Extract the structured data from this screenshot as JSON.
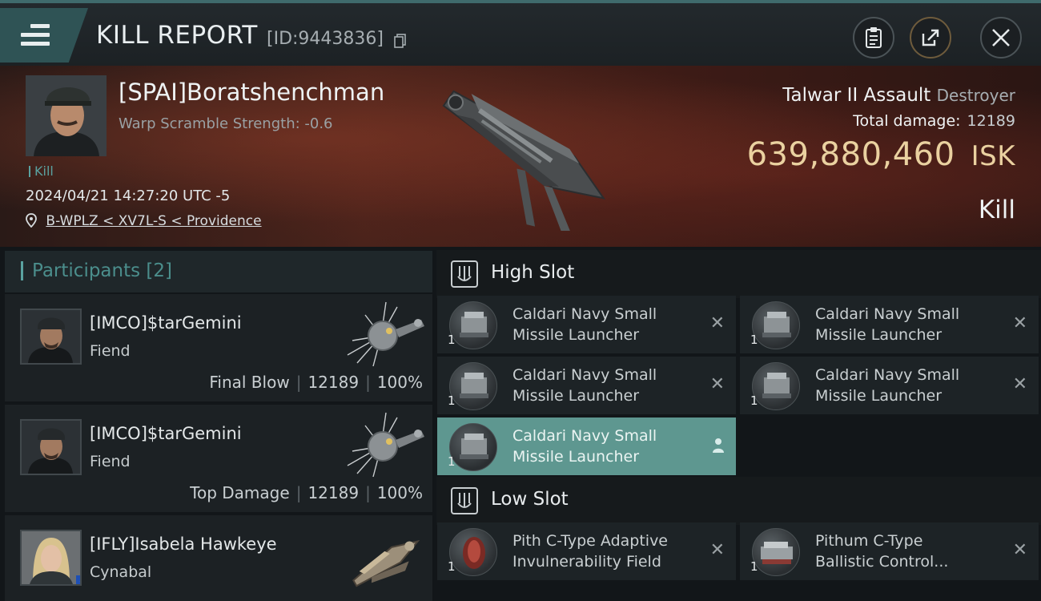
{
  "header": {
    "title": "KILL REPORT",
    "report_id": "[ID:9443836]",
    "icons": [
      "menu-icon",
      "copy-icon",
      "clipboard-icon",
      "share-icon",
      "close-icon"
    ]
  },
  "victim": {
    "name": "[SPAI]Boratshenchman",
    "scramble": "Warp Scramble Strength: -0.6",
    "kill_tag": "Kill",
    "datetime": "2024/04/21 14:27:20 UTC -5",
    "location": "B-WPLZ < XV7L-S < Providence",
    "ship_name": "Talwar II Assault",
    "ship_class": "Destroyer",
    "total_damage_label": "Total damage:",
    "total_damage": "12189",
    "isk_value": "639,880,460",
    "isk_unit": "ISK",
    "result": "Kill"
  },
  "participants": {
    "header": "Participants",
    "count": "[2]",
    "items": [
      {
        "name": "[IMCO]$tarGemini",
        "ship": "Fiend",
        "role": "Final Blow",
        "damage": "12189",
        "percent": "100%"
      },
      {
        "name": "[IMCO]$tarGemini",
        "ship": "Fiend",
        "role": "Top Damage",
        "damage": "12189",
        "percent": "100%"
      },
      {
        "name": "[IFLY]Isabela Hawkeye",
        "ship": "Cynabal",
        "role": "",
        "damage": "",
        "percent": ""
      }
    ]
  },
  "slots": {
    "high": {
      "title": "High Slot",
      "modules": [
        {
          "line1": "Caldari Navy Small",
          "line2": "Missile Launcher",
          "qty": "1",
          "state": "destroyed"
        },
        {
          "line1": "Caldari Navy Small",
          "line2": "Missile Launcher",
          "qty": "1",
          "state": "destroyed"
        },
        {
          "line1": "Caldari Navy Small",
          "line2": "Missile Launcher",
          "qty": "1",
          "state": "destroyed"
        },
        {
          "line1": "Caldari Navy Small",
          "line2": "Missile Launcher",
          "qty": "1",
          "state": "destroyed"
        },
        {
          "line1": "Caldari Navy Small",
          "line2": "Missile Launcher",
          "qty": "1",
          "state": "dropped"
        }
      ]
    },
    "low": {
      "title": "Low Slot",
      "modules": [
        {
          "line1": "Pith C-Type Adaptive",
          "line2": "Invulnerability Field",
          "qty": "1",
          "state": "destroyed"
        },
        {
          "line1": "Pithum C-Type",
          "line2": "Ballistic Control...",
          "qty": "1",
          "state": "destroyed"
        }
      ]
    },
    "destroyed_mark": "✕"
  },
  "colors": {
    "accent_teal": "#5aa2a0",
    "isk_gold": "#ead1a0",
    "highlight_row": "#5e9790"
  }
}
